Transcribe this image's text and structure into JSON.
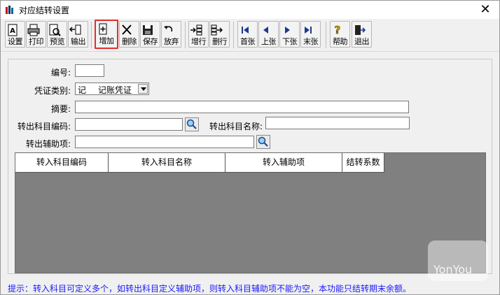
{
  "window": {
    "title": "对应结转设置"
  },
  "toolbar": {
    "buttons": [
      {
        "label": "设置",
        "icon": "settings-icon"
      },
      {
        "label": "打印",
        "icon": "print-icon"
      },
      {
        "label": "预览",
        "icon": "preview-icon"
      },
      {
        "label": "输出",
        "icon": "export-icon"
      },
      {
        "label": "增加",
        "icon": "add-icon"
      },
      {
        "label": "删除",
        "icon": "delete-icon"
      },
      {
        "label": "保存",
        "icon": "save-icon"
      },
      {
        "label": "放弃",
        "icon": "undo-icon"
      },
      {
        "label": "增行",
        "icon": "add-row-icon"
      },
      {
        "label": "删行",
        "icon": "delete-row-icon"
      },
      {
        "label": "首张",
        "icon": "first-icon"
      },
      {
        "label": "上张",
        "icon": "prev-icon"
      },
      {
        "label": "下张",
        "icon": "next-icon"
      },
      {
        "label": "末张",
        "icon": "last-icon"
      },
      {
        "label": "帮助",
        "icon": "help-icon"
      },
      {
        "label": "退出",
        "icon": "exit-icon"
      }
    ]
  },
  "form": {
    "number_label": "编号:",
    "number_value": "",
    "voucher_type_label": "凭证类别:",
    "voucher_type_code": "记",
    "voucher_type_name": "记账凭证",
    "summary_label": "摘要:",
    "summary_value": "",
    "out_code_label": "转出科目编码:",
    "out_code_value": "",
    "out_name_label": "转出科目名称:",
    "out_name_value": "",
    "out_aux_label": "转出辅助项:",
    "out_aux_value": ""
  },
  "grid": {
    "columns": [
      "转入科目编码",
      "转入科目名称",
      "转入辅助项",
      "结转系数"
    ],
    "rows": []
  },
  "watermark": "YonYou",
  "hint": "提示：转入科目可定义多个，如转出科目定义辅助项，则转入科目辅助项不能为空，本功能只结转期末余额。",
  "colors": {
    "grid_bg": "#808080",
    "hint": "#1a1aff",
    "highlight": "#e03030"
  }
}
